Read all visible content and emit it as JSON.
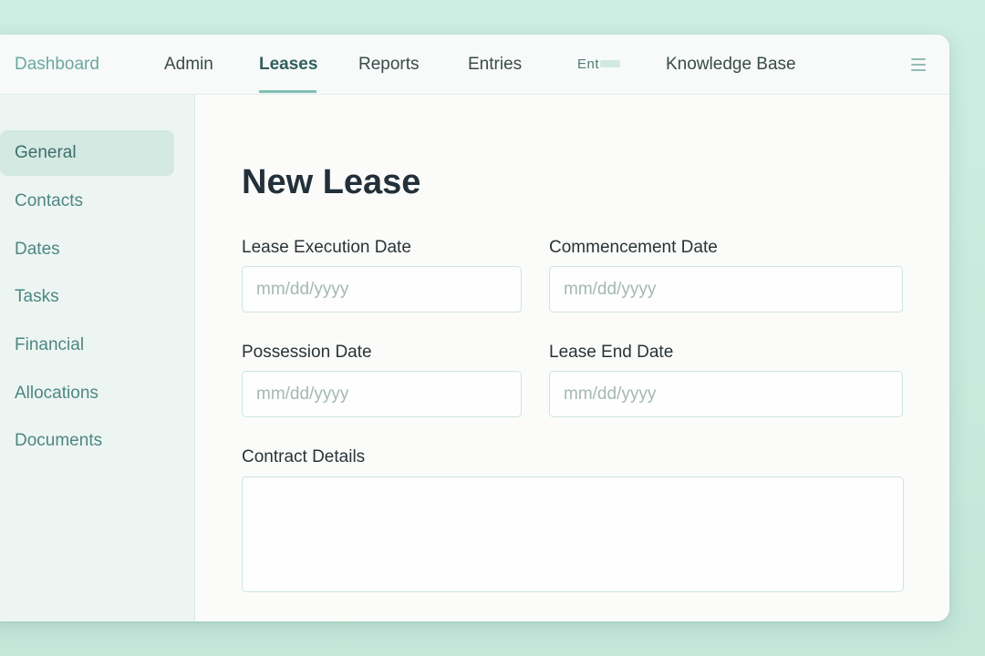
{
  "topnav": {
    "items": [
      {
        "label": "Dashboard"
      },
      {
        "label": "Admin"
      },
      {
        "label": "Leases"
      },
      {
        "label": "Reports"
      },
      {
        "label": "Entries"
      },
      {
        "label": "Ent"
      },
      {
        "label": "Knowledge Base"
      }
    ],
    "active": "Leases",
    "menu_icon": "hamburger-menu-icon"
  },
  "sidebar": {
    "items": [
      {
        "label": "General"
      },
      {
        "label": "Contacts"
      },
      {
        "label": "Dates"
      },
      {
        "label": "Tasks"
      },
      {
        "label": "Financial"
      },
      {
        "label": "Allocations"
      },
      {
        "label": "Documents"
      }
    ],
    "active": "General"
  },
  "main": {
    "title": "New Lease",
    "fields": {
      "lease_execution_date": {
        "label": "Lease Execution Date",
        "placeholder": "mm/dd/yyyy",
        "value": ""
      },
      "commencement_date": {
        "label": "Commencement Date",
        "placeholder": "mm/dd/yyyy",
        "value": ""
      },
      "possession_date": {
        "label": "Possession Date",
        "placeholder": "mm/dd/yyyy",
        "value": ""
      },
      "lease_end_date": {
        "label": "Lease End Date",
        "placeholder": "mm/dd/yyyy",
        "value": ""
      },
      "contract_details": {
        "label": "Contract Details",
        "value": ""
      }
    }
  },
  "colors": {
    "background": "#c8e9dd",
    "accent": "#7fbfb2",
    "sidebar_active": "#d3e9e2",
    "text_dark": "#23303a",
    "link_teal": "#4d8782"
  }
}
